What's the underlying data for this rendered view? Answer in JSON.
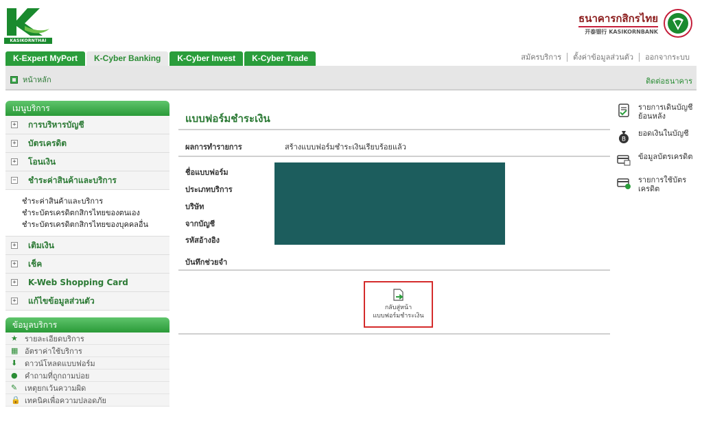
{
  "brand": {
    "logo_caption": "KASIKORNTHAI",
    "bank_name_th": "ธนาคารกสิกรไทย",
    "bank_name_en": "开泰银行 KASIKORNBANK"
  },
  "tabs": [
    {
      "label": "K-Expert MyPort",
      "active": false
    },
    {
      "label": "K-Cyber Banking",
      "active": true
    },
    {
      "label": "K-Cyber Invest",
      "active": false
    },
    {
      "label": "K-Cyber Trade",
      "active": false
    }
  ],
  "top_links": {
    "register": "สมัครบริการ",
    "settings": "ตั้งค่าข้อมูลส่วนตัว",
    "logout": "ออกจากระบบ"
  },
  "subbar": {
    "home": "หน้าหลัก",
    "contact": "ติดต่อธนาคาร"
  },
  "sidebar": {
    "menu_title": "เมนูบริการ",
    "items": [
      {
        "label": "การบริหารบัญชี",
        "expander": "+"
      },
      {
        "label": "บัตรเครดิต",
        "expander": "+"
      },
      {
        "label": "โอนเงิน",
        "expander": "+"
      },
      {
        "label": "ชำระค่าสินค้าและบริการ",
        "expander": "−"
      },
      {
        "label": "เติมเงิน",
        "expander": "+"
      },
      {
        "label": "เช็ค",
        "expander": "+"
      },
      {
        "label": "K-Web Shopping Card",
        "expander": "+"
      },
      {
        "label": "แก้ไขข้อมูลส่วนตัว",
        "expander": "+"
      }
    ],
    "sub_items": [
      "ชำระค่าสินค้าและบริการ",
      "ชำระบัตรเครดิตกสิกรไทยของตนเอง",
      "ชำระบัตรเครดิตกสิกรไทยของบุคคลอื่น"
    ],
    "info_title": "ข้อมูลบริการ",
    "info_items": [
      {
        "label": "รายละเอียดบริการ",
        "icon": "★"
      },
      {
        "label": "อัตราค่าใช้บริการ",
        "icon": "▦"
      },
      {
        "label": "ดาวน์โหลดแบบฟอร์ม",
        "icon": "⬇"
      },
      {
        "label": "คำถามที่ถูกถามบ่อย",
        "icon": "●"
      },
      {
        "label": "เหตุยกเว้นความผิด",
        "icon": "✎"
      },
      {
        "label": "เทคนิคเพื่อความปลอดภัย",
        "icon": "🔒"
      }
    ]
  },
  "main": {
    "title": "แบบฟอร์มชำระเงิน",
    "result_label": "ผลการทำรายการ",
    "result_value": "สร้างแบบฟอร์มชำระเงินเรียบร้อยแล้ว",
    "fields": [
      "ชื่อแบบฟอร์ม",
      "ประเภทบริการ",
      "บริษัท",
      "จากบัญชี",
      "รหัสอ้างอิง",
      "บันทึกช่วยจำ"
    ],
    "back_button": [
      "กลับสู่หน้า",
      "แบบฟอร์มชำระเงิน"
    ]
  },
  "right_panel": [
    {
      "label": "รายการเดินบัญชีย้อนหลัง",
      "icon": "statement-icon"
    },
    {
      "label": "ยอดเงินในบัญชี",
      "icon": "money-bag-icon"
    },
    {
      "label": "ข้อมูลบัตรเครดิต",
      "icon": "credit-card-icon"
    },
    {
      "label": "รายการใช้บัตรเครดิต",
      "icon": "card-usage-icon"
    }
  ],
  "colors": {
    "primary_green": "#2a9d3b",
    "text_green": "#2c7a35",
    "redaction": "#1c5d5d",
    "highlight_red": "#d42a2a"
  }
}
